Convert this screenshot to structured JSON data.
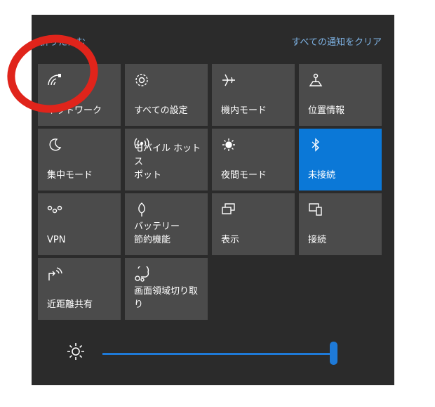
{
  "header": {
    "collapse_label": "折りたたむ",
    "clear_all_label": "すべての通知をクリア"
  },
  "tiles": [
    {
      "label": "ネットワーク",
      "icon": "wifi-icon",
      "active": false
    },
    {
      "label": "すべての設定",
      "icon": "gear-icon",
      "active": false
    },
    {
      "label": "機内モード",
      "icon": "airplane-icon",
      "active": false
    },
    {
      "label": "位置情報",
      "icon": "location-icon",
      "active": false
    },
    {
      "label": "集中モード",
      "icon": "moon-icon",
      "active": false
    },
    {
      "label": "モバイル ホットス\nポット",
      "icon": "hotspot-icon",
      "active": false
    },
    {
      "label": "夜間モード",
      "icon": "sun-icon",
      "active": false
    },
    {
      "label": "未接続",
      "icon": "bluetooth-icon",
      "active": true
    },
    {
      "label": "VPN",
      "icon": "vpn-icon",
      "active": false
    },
    {
      "label": "バッテリー\n節約機能",
      "icon": "battery-leaf-icon",
      "active": false
    },
    {
      "label": "表示",
      "icon": "display-icon",
      "active": false
    },
    {
      "label": "接続",
      "icon": "connect-icon",
      "active": false
    },
    {
      "label": "近距離共有",
      "icon": "nearby-share-icon",
      "active": false
    },
    {
      "label": "画面領域切り取\nり",
      "icon": "snip-icon",
      "active": false
    }
  ],
  "brightness": {
    "icon": "brightness-icon",
    "level": 1.0
  },
  "colors": {
    "panel": "#2b2b2b",
    "tile": "#4b4b4b",
    "active_tile": "#0b78d7",
    "link": "#7fb4e6",
    "annotation": "#e0241b"
  }
}
